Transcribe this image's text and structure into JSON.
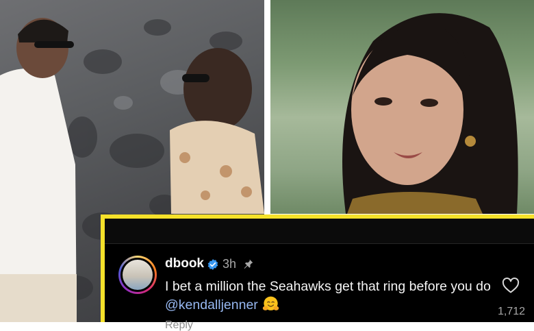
{
  "comment": {
    "username": "dbook",
    "time": "3h",
    "text": "I bet a million the Seahawks get that ring before you do ",
    "mention": "@kendalljenner",
    "likes": "1,712",
    "reply_label": "Reply"
  },
  "icons": {
    "verified": "verified-badge-icon",
    "pin": "pin-icon",
    "heart": "heart-outline-icon",
    "emoji": "hugging-face-emoji"
  },
  "colors": {
    "highlight_border": "#f5e12a",
    "card_background": "#000000",
    "mention": "#97b8f1",
    "verified": "#3897f0"
  }
}
